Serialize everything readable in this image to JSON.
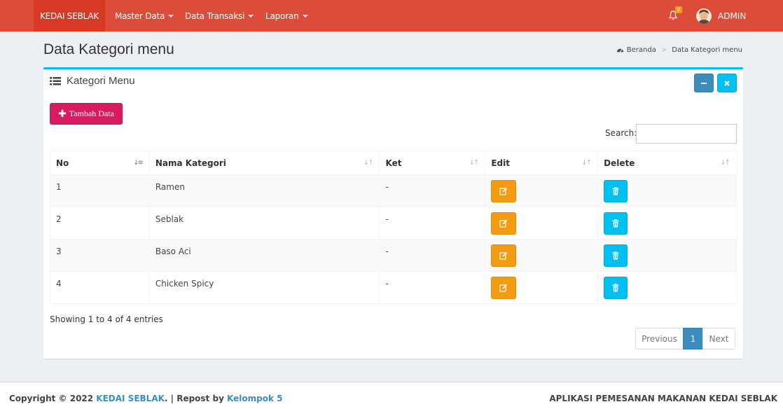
{
  "navbar": {
    "brand": "KEDAI SEBLAK",
    "menus": [
      {
        "label": "Master Data"
      },
      {
        "label": "Data Transaksi"
      },
      {
        "label": "Laporan"
      }
    ],
    "notification_count": "2",
    "user": "ADMIN",
    "colors": {
      "bar": "#dd4b39",
      "brand_bg": "#d73925"
    }
  },
  "header": {
    "title": "Data Kategori menu",
    "breadcrumb": [
      "Beranda",
      "Data Kategori menu"
    ]
  },
  "box": {
    "title": "Kategori Menu",
    "add_button": "Tambah Data",
    "search_label": "Search:",
    "search_value": "",
    "columns": [
      "No",
      "Nama Kategori",
      "Ket",
      "Edit",
      "Delete"
    ],
    "rows": [
      {
        "no": "1",
        "nama": "Ramen",
        "ket": "-"
      },
      {
        "no": "2",
        "nama": "Seblak",
        "ket": "-"
      },
      {
        "no": "3",
        "nama": "Baso Aci",
        "ket": "-"
      },
      {
        "no": "4",
        "nama": "Chicken Spicy",
        "ket": "-"
      }
    ],
    "showing": "Showing 1 to 4 of 4 entries",
    "pagination": {
      "previous": "Previous",
      "current": "1",
      "next": "Next"
    }
  },
  "footer": {
    "copyright_prefix": "Copyright © 2022 ",
    "brand_link": "KEDAI SEBLAK",
    "middle": ". | Repost by ",
    "author_link": "Kelompok 5",
    "app_name": "APLIKASI PEMESANAN MAKANAN KEDAI SEBLAK"
  }
}
